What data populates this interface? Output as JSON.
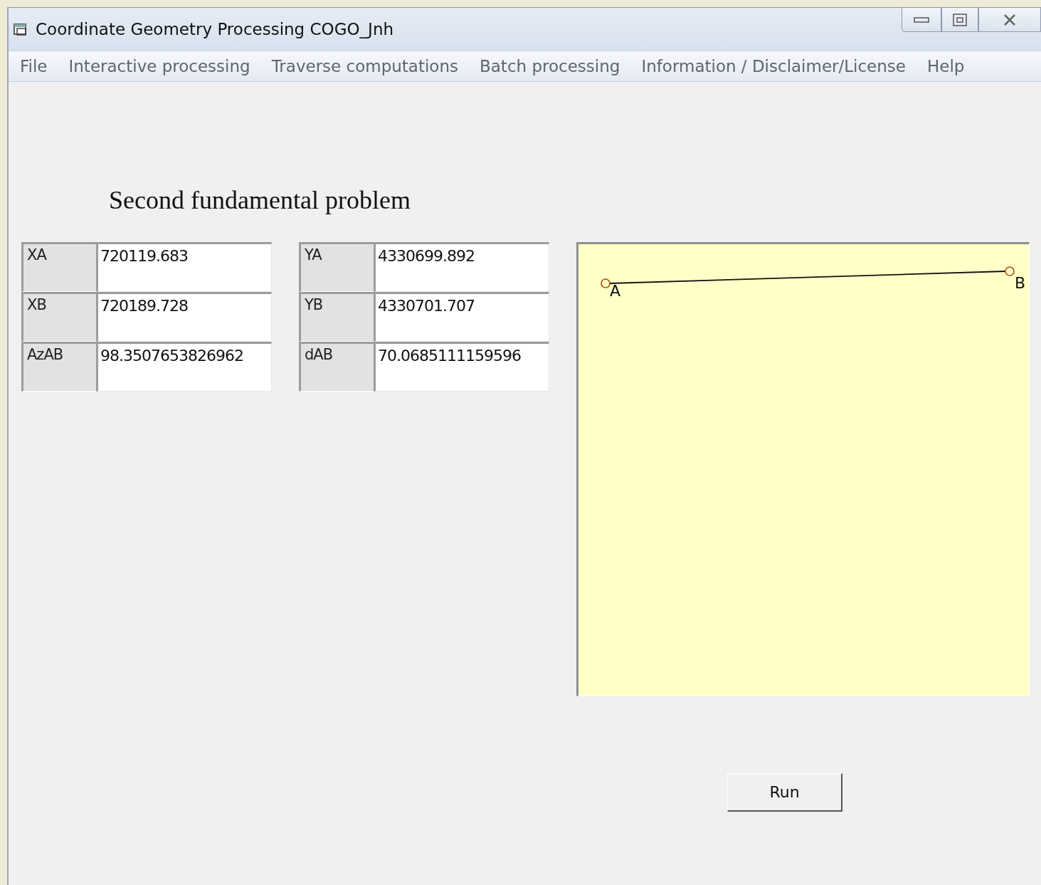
{
  "window": {
    "title": "Coordinate Geometry Processing COGO_Jnh"
  },
  "menu": [
    "File",
    "Interactive processing",
    "Traverse computations",
    "Batch processing",
    "Information / Disclaimer/License",
    "Help"
  ],
  "heading": "Second fundamental problem",
  "grids": [
    {
      "rows": [
        {
          "label": "XA",
          "value": "720119.683"
        },
        {
          "label": "XB",
          "value": "720189.728"
        },
        {
          "label": "AzAB",
          "value": "98.3507653826962"
        }
      ]
    },
    {
      "rows": [
        {
          "label": "YA",
          "value": "4330699.892"
        },
        {
          "label": "YB",
          "value": "4330701.707"
        },
        {
          "label": "dAB",
          "value": "70.0685111159596"
        }
      ]
    }
  ],
  "plot": {
    "points": [
      {
        "label": "A"
      },
      {
        "label": "B"
      }
    ]
  },
  "run_button": "Run"
}
